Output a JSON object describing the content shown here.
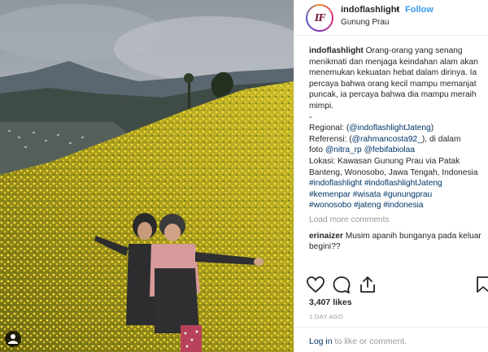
{
  "post": {
    "username": "indoflashlight",
    "separator": "•",
    "follow_label": "Follow",
    "location": "Gunung Prau",
    "avatar_text": "IF"
  },
  "caption": {
    "username": "indoflashlight",
    "text": "Orang-orang yang senang menikmati dan menjaga keindahan alam akan menemukan kekuatan hebat dalam dirinya. Ia percaya bahwa orang kecil mampu memanjat puncak, ia percaya bahwa dia mampu meraih mimpi.",
    "dash": "-",
    "regional_prefix": "Regional: (",
    "regional_mention": "@indoflashlightJateng",
    "regional_suffix": ")",
    "referensi_prefix": "Referensi: (",
    "referensi_mention": "@rahmancosta92_",
    "referensi_suffix": "), di dalam",
    "foto_prefix": "foto ",
    "foto_mention_1": "@nitra_rp",
    "foto_mention_2": "@febifabiolaa",
    "lokasi": "Lokasi: Kawasan Gunung Prau via Patak Banteng, Wonosobo, Jawa Tengah, Indonesia",
    "hashtags_line1": "#indoflashlight #indoflashlightJateng",
    "hashtags_line2": "#kemenpar #wisata #gunungprau",
    "hashtags_line3": "#wonosobo #jateng #indonesia"
  },
  "load_more_label": "Load more comments",
  "comment": {
    "username": "erinaizer",
    "text": "Musim apanih bunganya pada keluar begini??"
  },
  "likes": "3,407 likes",
  "date": "1 DAY AGO",
  "login": {
    "link": "Log in",
    "rest": " to like or comment."
  },
  "icons": {
    "like": "heart-icon",
    "comment": "comment-icon",
    "share": "share-icon",
    "save": "bookmark-icon",
    "user_tag": "user-tag-icon"
  },
  "colors": {
    "link_blue": "#3897f0",
    "mention_blue": "#003569",
    "muted": "#999999",
    "text": "#262626"
  }
}
